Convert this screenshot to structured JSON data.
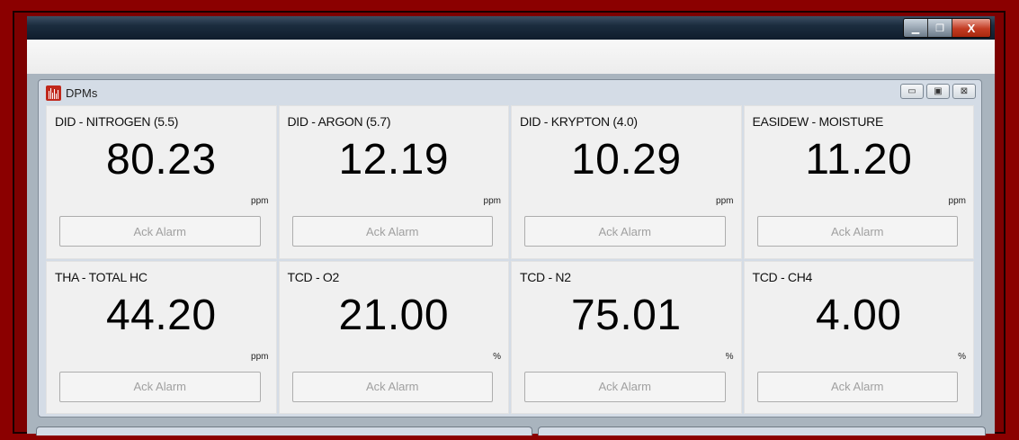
{
  "window": {
    "buttons": {
      "minimize": "▁",
      "restore": "❐",
      "close": "X"
    }
  },
  "child_window": {
    "title": "DPMs",
    "icon": "bar-chart-icon",
    "buttons": {
      "minimize": "▭",
      "restore": "▣",
      "close": "⊠"
    }
  },
  "tiles": [
    {
      "label": "DID - NITROGEN (5.5)",
      "value": "80.23",
      "unit": "ppm",
      "button": "Ack Alarm"
    },
    {
      "label": "DID - ARGON (5.7)",
      "value": "12.19",
      "unit": "ppm",
      "button": "Ack Alarm"
    },
    {
      "label": "DID - KRYPTON (4.0)",
      "value": "10.29",
      "unit": "ppm",
      "button": "Ack Alarm"
    },
    {
      "label": "EASIDEW - MOISTURE",
      "value": "11.20",
      "unit": "ppm",
      "button": "Ack Alarm"
    },
    {
      "label": "THA - TOTAL HC",
      "value": "44.20",
      "unit": "ppm",
      "button": "Ack Alarm"
    },
    {
      "label": "TCD - O2",
      "value": "21.00",
      "unit": "%",
      "button": "Ack Alarm"
    },
    {
      "label": "TCD - N2",
      "value": "75.01",
      "unit": "%",
      "button": "Ack Alarm"
    },
    {
      "label": "TCD - CH4",
      "value": "4.00",
      "unit": "%",
      "button": "Ack Alarm"
    }
  ],
  "colors": {
    "frame": "#8b0000",
    "alarm_disabled_text": "#a0a0a0"
  }
}
